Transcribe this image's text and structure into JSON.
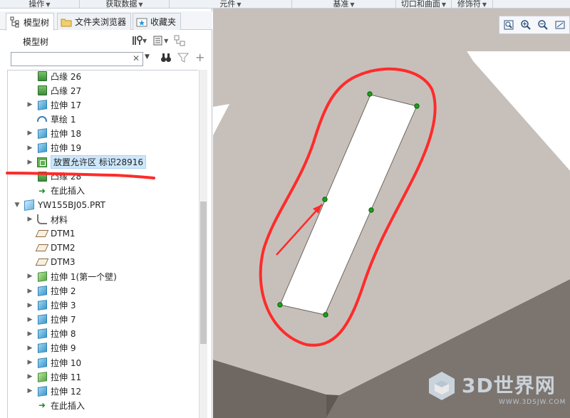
{
  "ribbon": {
    "groups": [
      {
        "label": "操作"
      },
      {
        "label": "获取数据"
      },
      {
        "label": "元件"
      },
      {
        "label": "基准"
      },
      {
        "label": "切口和曲面"
      },
      {
        "label": "修饰符"
      }
    ]
  },
  "tabs": [
    {
      "label": "模型树"
    },
    {
      "label": "文件夹浏览器"
    },
    {
      "label": "收藏夹"
    }
  ],
  "model_tree": {
    "title": "模型树",
    "search": {
      "value": "",
      "placeholder": ""
    },
    "items": [
      {
        "label": "凸缘 26",
        "icon": "flange-icon",
        "expand": false
      },
      {
        "label": "凸缘 27",
        "icon": "flange-icon",
        "expand": false
      },
      {
        "label": "拉伸 17",
        "icon": "extrude-icon",
        "expand": true
      },
      {
        "label": "草绘 1",
        "icon": "sketch-icon",
        "expand": false
      },
      {
        "label": "拉伸 18",
        "icon": "extrude-icon",
        "expand": true
      },
      {
        "label": "拉伸 19",
        "icon": "extrude-icon",
        "expand": true
      },
      {
        "label": "放置允许区 标识28916",
        "icon": "placement-zone-icon",
        "expand": true,
        "selected": true
      },
      {
        "label": "凸缘 28",
        "icon": "flange-icon",
        "expand": false
      },
      {
        "label": "在此插入",
        "icon": "insert-here-icon",
        "expand": false
      },
      {
        "label": "YW155BJ05.PRT",
        "icon": "part-icon",
        "expand": "open"
      },
      {
        "label": "材料",
        "icon": "material-icon",
        "expand": true
      },
      {
        "label": "DTM1",
        "icon": "datum-plane-icon",
        "expand": false
      },
      {
        "label": "DTM2",
        "icon": "datum-plane-icon",
        "expand": false
      },
      {
        "label": "DTM3",
        "icon": "datum-plane-icon",
        "expand": false
      },
      {
        "label": "拉伸 1(第一个壁)",
        "icon": "first-wall-icon",
        "expand": true
      },
      {
        "label": "拉伸 2",
        "icon": "extrude-icon",
        "expand": true
      },
      {
        "label": "拉伸 3",
        "icon": "extrude-icon",
        "expand": true
      },
      {
        "label": "拉伸 7",
        "icon": "extrude-icon",
        "expand": true
      },
      {
        "label": "拉伸 8",
        "icon": "extrude-icon",
        "expand": true
      },
      {
        "label": "拉伸 9",
        "icon": "extrude-icon",
        "expand": true
      },
      {
        "label": "拉伸 10",
        "icon": "extrude-icon",
        "expand": true
      },
      {
        "label": "拉伸 11",
        "icon": "first-wall-icon",
        "expand": true
      },
      {
        "label": "拉伸 12",
        "icon": "extrude-icon",
        "expand": true
      },
      {
        "label": "在此插入",
        "icon": "insert-here-icon",
        "expand": false
      }
    ]
  },
  "viewport": {
    "toolbar": [
      "zoom-fit-icon",
      "zoom-in-icon",
      "zoom-out-icon",
      "repaint-icon"
    ]
  },
  "watermark": {
    "text": "3D世界网",
    "sub": "WWW.3DSJW.COM"
  },
  "colors": {
    "part_face": "#c7c0ba",
    "part_side": "#8a837d",
    "annotation_red": "#ff2b2b",
    "selection_bg": "#cde7fb",
    "snap_point": "#1aa01a"
  }
}
